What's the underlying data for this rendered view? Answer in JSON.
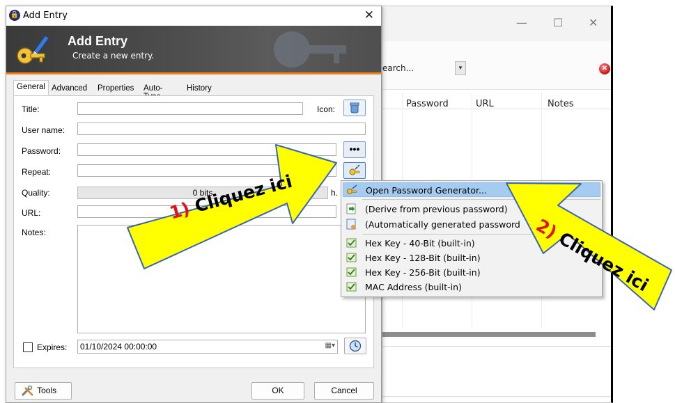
{
  "main_window": {
    "search_text": "earch...",
    "columns": [
      "Password",
      "URL",
      "Notes"
    ]
  },
  "dialog": {
    "title": "Add Entry",
    "banner_title": "Add Entry",
    "banner_subtitle": "Create a new entry.",
    "tabs": [
      "General",
      "Advanced",
      "Properties",
      "Auto-Type",
      "History"
    ],
    "labels": {
      "title": "Title:",
      "icon": "Icon:",
      "user_name": "User name:",
      "password": "Password:",
      "repeat": "Repeat:",
      "quality": "Quality:",
      "url": "URL:",
      "notes": "Notes:",
      "expires": "Expires:"
    },
    "values": {
      "title": "",
      "user_name": "",
      "password": "",
      "repeat": "",
      "url": "",
      "quality_text": "0 bits",
      "quality_trailing": "h.",
      "expires_date": "01/10/2024 00:00:00"
    },
    "buttons": {
      "tools": "Tools",
      "ok": "OK",
      "cancel": "Cancel",
      "show_password": "•••"
    }
  },
  "context_menu": {
    "items": [
      {
        "label": "Open Password Generator...",
        "highlighted": true
      },
      {
        "label": "(Derive from previous password)"
      },
      {
        "label": "(Automatically generated password"
      },
      {
        "label": "Hex Key - 40-Bit (built-in)"
      },
      {
        "label": "Hex Key - 128-Bit (built-in)"
      },
      {
        "label": "Hex Key - 256-Bit (built-in)"
      },
      {
        "label": "MAC Address (built-in)"
      }
    ]
  },
  "callouts": {
    "first": {
      "number": "1)",
      "text": "Cliquez ici"
    },
    "second": {
      "number": "2)",
      "text": "Cliquez ici"
    }
  },
  "colors": {
    "callout_fill": "#ffff00",
    "callout_stroke": "#3a64b4",
    "banner_accent": "#f07f1b",
    "menu_highlight": "#a5ccf0"
  }
}
